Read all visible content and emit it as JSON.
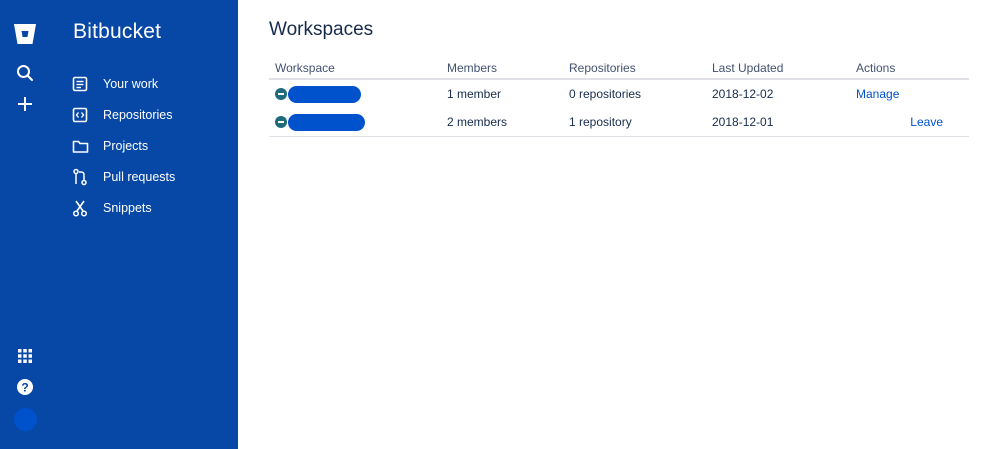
{
  "rail": {
    "logo_icon": "bitbucket-logo-icon",
    "search_icon": "search-icon",
    "create_icon": "plus-icon",
    "apps_icon": "app-switcher-icon",
    "help_icon": "help-icon",
    "profile_icon": "avatar"
  },
  "sidebar": {
    "product_title": "Bitbucket",
    "items": [
      {
        "label": "Your work",
        "icon": "your-work-icon"
      },
      {
        "label": "Repositories",
        "icon": "repositories-icon"
      },
      {
        "label": "Projects",
        "icon": "folder-icon"
      },
      {
        "label": "Pull requests",
        "icon": "pull-request-icon"
      },
      {
        "label": "Snippets",
        "icon": "snippets-icon"
      }
    ]
  },
  "main": {
    "title": "Workspaces",
    "table": {
      "columns": [
        "Workspace",
        "Members",
        "Repositories",
        "Last Updated",
        "Actions"
      ],
      "rows": [
        {
          "workspace": "",
          "members": "1 member",
          "repositories": "0 repositories",
          "last_updated": "2018-12-02",
          "action": "Manage"
        },
        {
          "workspace": "",
          "members": "2 members",
          "repositories": "1 repository",
          "last_updated": "2018-12-01",
          "action": "Leave"
        }
      ]
    }
  },
  "colors": {
    "sidebar_bg": "#0747a6",
    "link": "#0052cc",
    "text": "#172b4d"
  }
}
